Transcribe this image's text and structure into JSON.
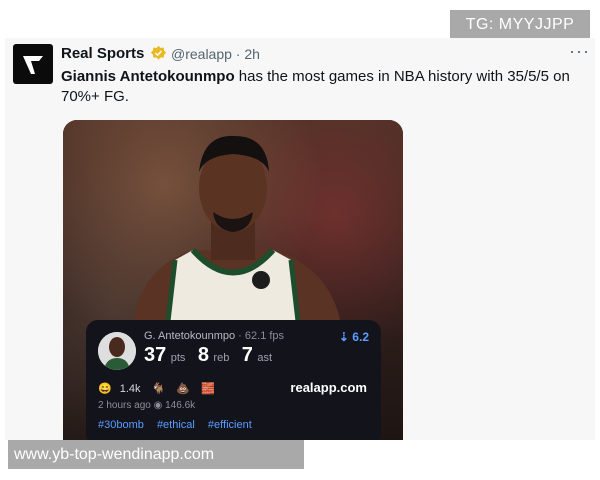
{
  "watermark_top": "TG: MYYJJPP",
  "watermark_bottom": "www.yb-top-wendinapp.com",
  "tweet": {
    "author": "Real Sports",
    "handle_time": "@realapp · 2h",
    "more": "···",
    "text_bold": "Giannis Antetokounmpo",
    "text_rest": " has the most games in NBA history with 35/5/5 on 70%+ FG."
  },
  "stat_card": {
    "player_name": "G. Antetokounmpo",
    "fps": " · 62.1 fps",
    "rating": "⇣ 6.2",
    "pts": "37",
    "pts_label": "pts",
    "reb": "8",
    "reb_label": "reb",
    "ast": "7",
    "ast_label": "ast",
    "reaction_count": "1.4k",
    "brand": "realapp.com",
    "time_ago": "2 hours ago",
    "views": "146.6k",
    "tags": [
      "#30bomb",
      "#ethical",
      "#efficient"
    ]
  },
  "icons": {
    "avatar": "real-sports-logo",
    "verified": "verified-badge-icon",
    "eye": "eye-icon"
  }
}
